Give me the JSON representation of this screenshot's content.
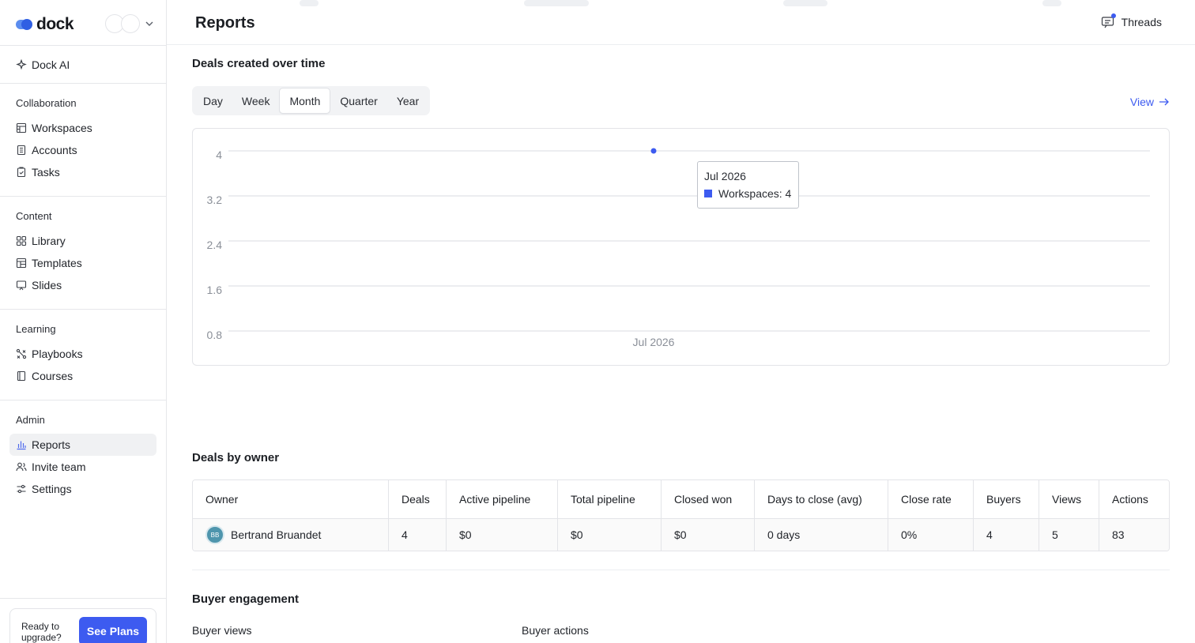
{
  "brand": {
    "name": "dock"
  },
  "sidebar": {
    "dock_ai": "Dock AI",
    "sections": [
      {
        "title": "Collaboration",
        "items": [
          "Workspaces",
          "Accounts",
          "Tasks"
        ]
      },
      {
        "title": "Content",
        "items": [
          "Library",
          "Templates",
          "Slides"
        ]
      },
      {
        "title": "Learning",
        "items": [
          "Playbooks",
          "Courses"
        ]
      },
      {
        "title": "Admin",
        "items": [
          "Reports",
          "Invite team",
          "Settings"
        ]
      }
    ],
    "active_item": "Reports",
    "upgrade": {
      "text": "Ready to upgrade?",
      "button": "See Plans"
    }
  },
  "header": {
    "title": "Reports",
    "threads": "Threads"
  },
  "deals_over_time": {
    "title": "Deals created over time",
    "periods": [
      "Day",
      "Week",
      "Month",
      "Quarter",
      "Year"
    ],
    "active_period": "Month",
    "view_link": "View"
  },
  "chart_data": {
    "type": "line",
    "x": [
      "Jul 2026"
    ],
    "series": [
      {
        "name": "Workspaces",
        "values": [
          4
        ]
      }
    ],
    "yticks": [
      "4",
      "3.2",
      "2.4",
      "1.6",
      "0.8"
    ],
    "ylim": [
      0.8,
      4
    ],
    "tooltip": {
      "label": "Jul 2026",
      "series_text": "Workspaces: 4"
    },
    "colors": {
      "series": "#3d5bf0",
      "grid": "#d9dbe0"
    }
  },
  "deals_by_owner": {
    "title": "Deals by owner",
    "columns": [
      "Owner",
      "Deals",
      "Active pipeline",
      "Total pipeline",
      "Closed won",
      "Days to close (avg)",
      "Close rate",
      "Buyers",
      "Views",
      "Actions"
    ],
    "rows": [
      {
        "initials": "BB",
        "owner": "Bertrand Bruandet",
        "deals": "4",
        "active_pipeline": "$0",
        "total_pipeline": "$0",
        "closed_won": "$0",
        "days_to_close": "0 days",
        "close_rate": "0%",
        "buyers": "4",
        "views": "5",
        "actions": "83"
      }
    ]
  },
  "buyer_engagement": {
    "title": "Buyer engagement",
    "buyer_views": "Buyer views",
    "buyer_actions": "Buyer actions"
  }
}
